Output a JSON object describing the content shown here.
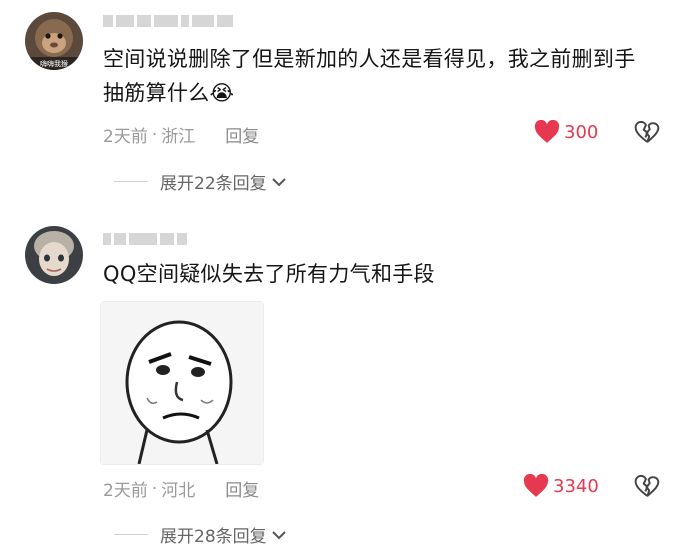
{
  "comments": [
    {
      "text_line1": "空间说说删除了但是新加的人还是看得见，我之前删到手",
      "text_line2": "抽筋算什么",
      "emoji": "😭",
      "avatar_caption": "嗨嗨我猴",
      "time": "2天前",
      "location": "浙江",
      "reply_label": "回复",
      "likes": "300",
      "expand_label": "展开22条回复"
    },
    {
      "text_line1": "QQ空间疑似失去了所有力气和手段",
      "time": "2天前",
      "location": "河北",
      "reply_label": "回复",
      "likes": "3340",
      "expand_label": "展开28条回复"
    }
  ],
  "separator": "·",
  "colors": {
    "like": "#e6394f",
    "meta": "#9a9a9a",
    "text": "#161616"
  }
}
